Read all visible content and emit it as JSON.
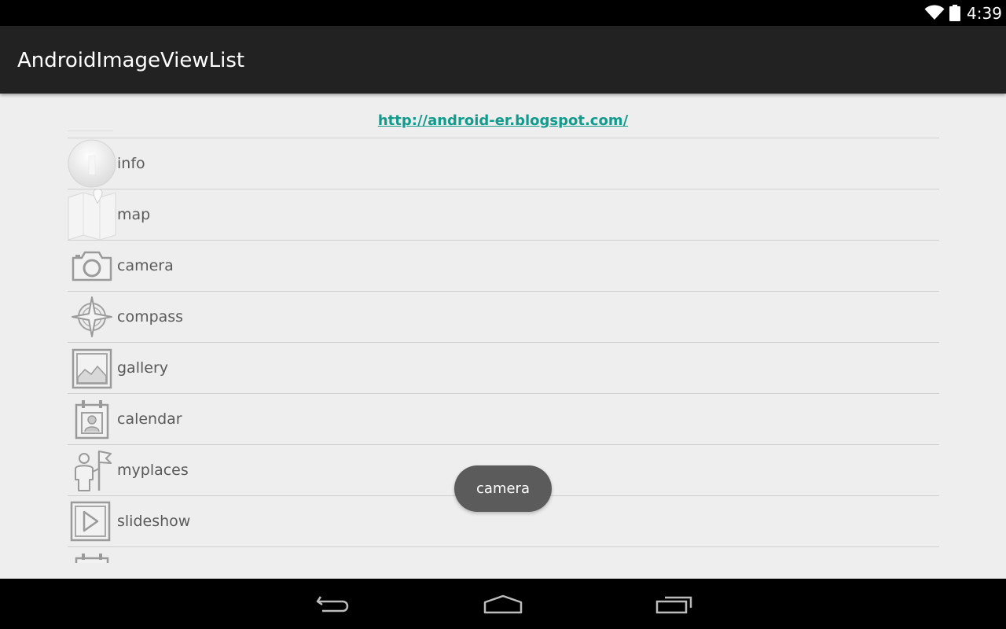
{
  "status_bar": {
    "time": "4:39",
    "icons": [
      "wifi-icon",
      "battery-icon"
    ]
  },
  "action_bar": {
    "title": "AndroidImageViewList"
  },
  "content": {
    "link_text": "http://android-er.blogspot.com/",
    "link_color": "#129a8c",
    "items": [
      {
        "label": "info",
        "icon": "info-icon"
      },
      {
        "label": "map",
        "icon": "map-icon"
      },
      {
        "label": "camera",
        "icon": "camera-icon"
      },
      {
        "label": "compass",
        "icon": "compass-icon"
      },
      {
        "label": "gallery",
        "icon": "gallery-icon"
      },
      {
        "label": "calendar",
        "icon": "calendar-icon"
      },
      {
        "label": "myplaces",
        "icon": "myplaces-icon"
      },
      {
        "label": "slideshow",
        "icon": "slideshow-icon"
      }
    ]
  },
  "toast": {
    "text": "camera"
  },
  "nav_bar": {
    "buttons": [
      "back-icon",
      "home-icon",
      "recents-icon"
    ]
  }
}
